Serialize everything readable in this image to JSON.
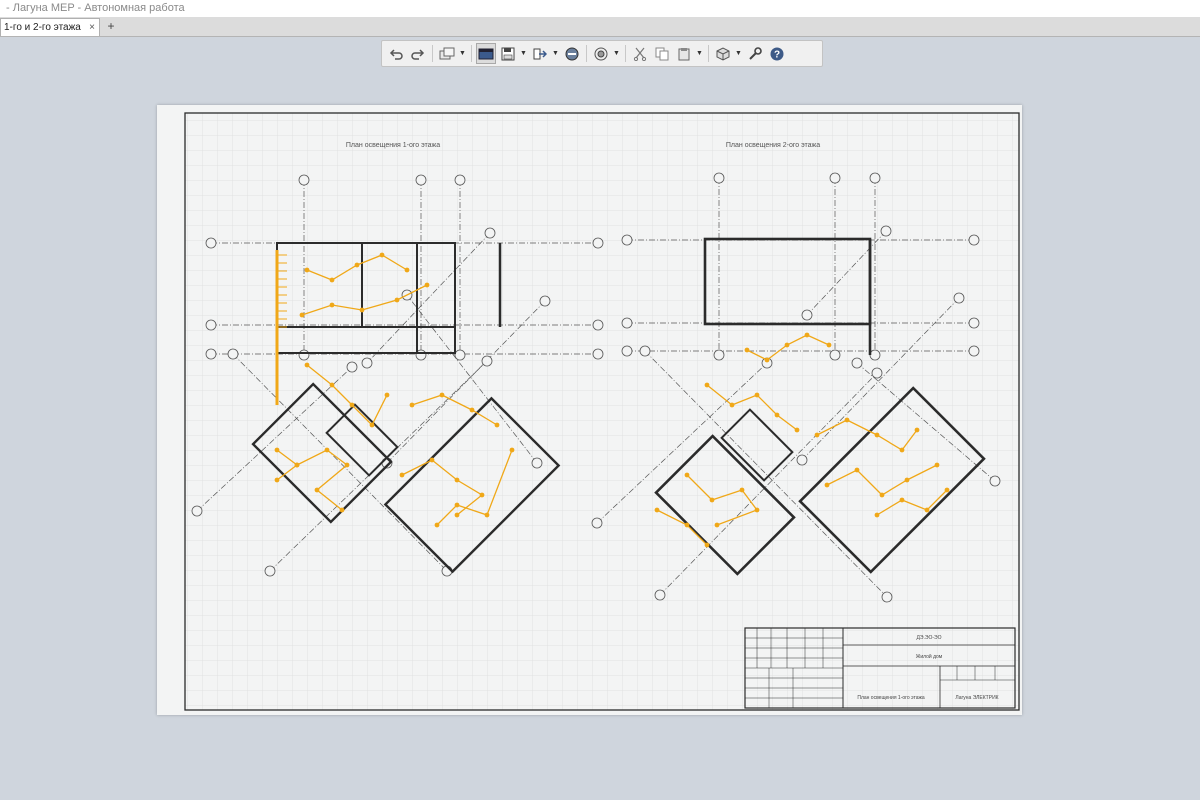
{
  "window": {
    "title": "- Лагуна MEP - Автономная работа"
  },
  "tabs": [
    {
      "label": "1-го и 2-го этажа",
      "close": "×"
    }
  ],
  "tab_add": "+",
  "toolbar": {
    "icons": [
      "undo-icon",
      "redo-icon",
      "layers-icon",
      "sheet-view-icon",
      "save-icon",
      "export-icon",
      "print-icon",
      "open-icon",
      "cut-icon",
      "copy-icon",
      "paste-icon",
      "view-3d-icon",
      "settings-icon",
      "help-icon"
    ]
  },
  "sheet": {
    "plans": [
      "План освещения 1-ого этажа",
      "План освещения 2-ого этажа"
    ],
    "stamp": {
      "code": "ДЭ.ЭО-ЭО",
      "name": "Жилой дом",
      "plan": "План освещения 1-ого этажа",
      "org": "Лагуна ЭЛЕКТРИК"
    }
  },
  "colors": {
    "accent": "#f0a818",
    "line": "#2b2b2b",
    "grid": "#e1e3e3",
    "sheet": "#f3f4f4"
  }
}
